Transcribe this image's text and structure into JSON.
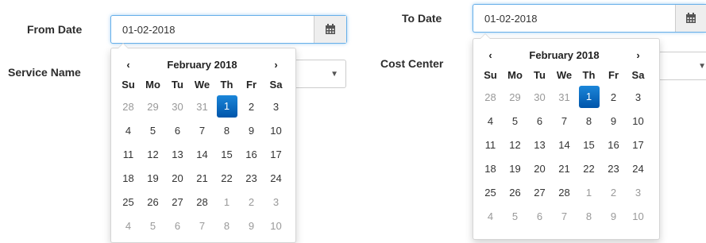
{
  "from": {
    "label": "From Date",
    "value": "01-02-2018",
    "calendar": {
      "month_title": "February 2018",
      "prev": "‹",
      "next": "›",
      "weekdays": [
        "Su",
        "Mo",
        "Tu",
        "We",
        "Th",
        "Fr",
        "Sa"
      ],
      "weeks": [
        [
          "28",
          "29",
          "30",
          "31",
          "1",
          "2",
          "3"
        ],
        [
          "4",
          "5",
          "6",
          "7",
          "8",
          "9",
          "10"
        ],
        [
          "11",
          "12",
          "13",
          "14",
          "15",
          "16",
          "17"
        ],
        [
          "18",
          "19",
          "20",
          "21",
          "22",
          "23",
          "24"
        ],
        [
          "25",
          "26",
          "27",
          "28",
          "1",
          "2",
          "3"
        ],
        [
          "4",
          "5",
          "6",
          "7",
          "8",
          "9",
          "10"
        ]
      ],
      "muted": [
        [
          0,
          0
        ],
        [
          0,
          1
        ],
        [
          0,
          2
        ],
        [
          0,
          3
        ],
        [
          4,
          4
        ],
        [
          4,
          5
        ],
        [
          4,
          6
        ],
        [
          5,
          0
        ],
        [
          5,
          1
        ],
        [
          5,
          2
        ],
        [
          5,
          3
        ],
        [
          5,
          4
        ],
        [
          5,
          5
        ],
        [
          5,
          6
        ]
      ],
      "selected": [
        0,
        4
      ]
    }
  },
  "to": {
    "label": "To Date",
    "value": "01-02-2018",
    "calendar": {
      "month_title": "February 2018",
      "prev": "‹",
      "next": "›",
      "weekdays": [
        "Su",
        "Mo",
        "Tu",
        "We",
        "Th",
        "Fr",
        "Sa"
      ],
      "weeks": [
        [
          "28",
          "29",
          "30",
          "31",
          "1",
          "2",
          "3"
        ],
        [
          "4",
          "5",
          "6",
          "7",
          "8",
          "9",
          "10"
        ],
        [
          "11",
          "12",
          "13",
          "14",
          "15",
          "16",
          "17"
        ],
        [
          "18",
          "19",
          "20",
          "21",
          "22",
          "23",
          "24"
        ],
        [
          "25",
          "26",
          "27",
          "28",
          "1",
          "2",
          "3"
        ],
        [
          "4",
          "5",
          "6",
          "7",
          "8",
          "9",
          "10"
        ]
      ],
      "muted": [
        [
          0,
          0
        ],
        [
          0,
          1
        ],
        [
          0,
          2
        ],
        [
          0,
          3
        ],
        [
          4,
          4
        ],
        [
          4,
          5
        ],
        [
          4,
          6
        ],
        [
          5,
          0
        ],
        [
          5,
          1
        ],
        [
          5,
          2
        ],
        [
          5,
          3
        ],
        [
          5,
          4
        ],
        [
          5,
          5
        ],
        [
          5,
          6
        ]
      ],
      "selected": [
        0,
        4
      ]
    }
  },
  "service": {
    "label": "Service Name",
    "value": ""
  },
  "cost_center": {
    "label": "Cost Center",
    "value": ""
  },
  "icons": {
    "calendar": "calendar-icon",
    "dropdown": "caret-down-icon"
  },
  "colors": {
    "focus_border": "#66afe9",
    "selected_day": "#0a6fc9",
    "addon_bg": "#eeeeee"
  }
}
